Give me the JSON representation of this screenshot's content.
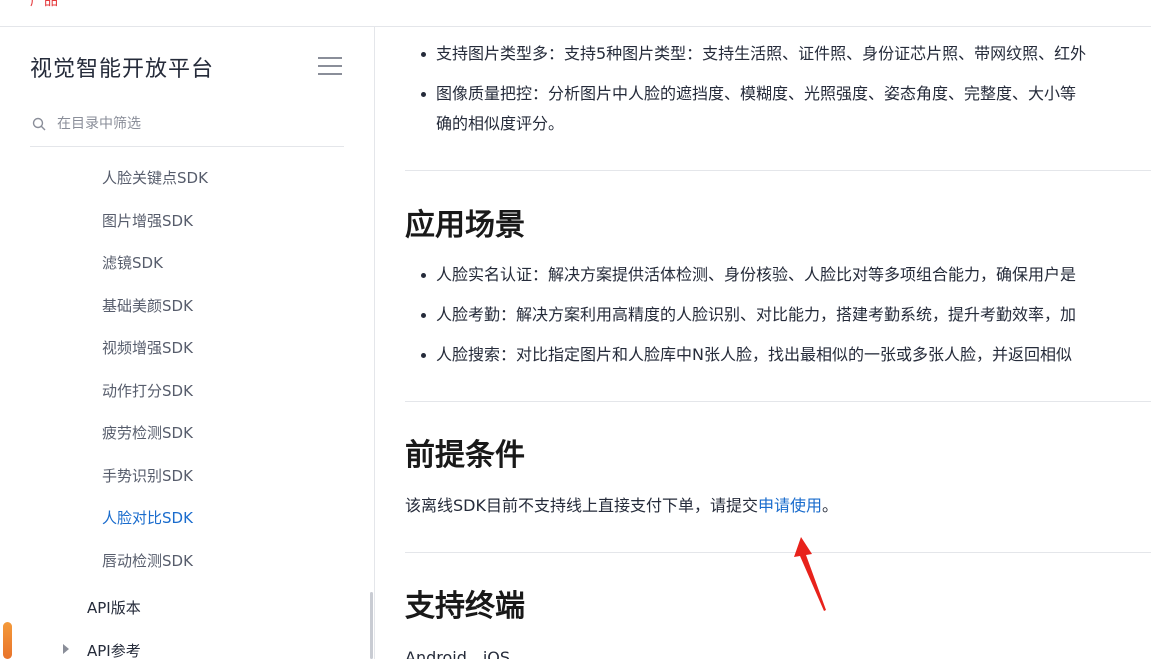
{
  "topbar": {
    "clip_text": "产品"
  },
  "sidebar": {
    "title": "视觉智能开放平台",
    "search_placeholder": "在目录中筛选",
    "items": [
      {
        "label": "人脸关键点SDK",
        "active": false
      },
      {
        "label": "图片增强SDK",
        "active": false
      },
      {
        "label": "滤镜SDK",
        "active": false
      },
      {
        "label": "基础美颜SDK",
        "active": false
      },
      {
        "label": "视频增强SDK",
        "active": false
      },
      {
        "label": "动作打分SDK",
        "active": false
      },
      {
        "label": "疲劳检测SDK",
        "active": false
      },
      {
        "label": "手势识别SDK",
        "active": false
      },
      {
        "label": "人脸对比SDK",
        "active": true
      },
      {
        "label": "唇动检测SDK",
        "active": false
      }
    ],
    "level1": [
      {
        "label": "API版本"
      },
      {
        "label": "API参考"
      }
    ]
  },
  "content": {
    "features": [
      {
        "text": "支持图片类型多：支持5种图片类型：支持生活照、证件照、身份证芯片照、带网纹照、红外"
      },
      {
        "text": "图像质量把控：分析图片中人脸的遮挡度、模糊度、光照强度、姿态角度、完整度、大小等"
      },
      {
        "text": "确的相似度评分。"
      }
    ],
    "section_scenes": {
      "heading": "应用场景",
      "items": [
        "人脸实名认证：解决方案提供活体检测、身份核验、人脸比对等多项组合能力，确保用户是",
        "人脸考勤：解决方案利用高精度的人脸识别、对比能力，搭建考勤系统，提升考勤效率，加",
        "人脸搜索：对比指定图片和人脸库中N张人脸，找出最相似的一张或多张人脸，并返回相似"
      ]
    },
    "section_prereq": {
      "heading": "前提条件",
      "text_before": "该离线SDK目前不支持线上直接支付下单，请提交",
      "link": "申请使用",
      "text_after": "。"
    },
    "section_terminal": {
      "heading": "支持终端",
      "text": "Android、iOS"
    }
  },
  "colors": {
    "accent": "#1a6ccd",
    "annotation_arrow": "#e8221b"
  }
}
